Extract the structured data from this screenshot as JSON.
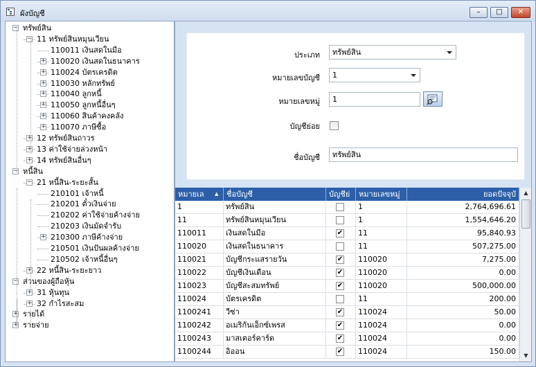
{
  "window": {
    "title": "ผังบัญชี",
    "minimize": "–",
    "maximize": "□",
    "close": "✕"
  },
  "tree": [
    {
      "label": "ทรัพย์สิน",
      "level": 0,
      "expander": "−"
    },
    {
      "label": "11 ทรัพย์สินหมุนเวียน",
      "level": 1,
      "expander": "−"
    },
    {
      "label": "110011 เงินสดในมือ",
      "level": 2,
      "expander": ""
    },
    {
      "label": "110020 เงินสดในธนาคาร",
      "level": 2,
      "expander": "+"
    },
    {
      "label": "110024 บัตรเครดิต",
      "level": 2,
      "expander": "+"
    },
    {
      "label": "110030 หลักทรัพย์",
      "level": 2,
      "expander": "+"
    },
    {
      "label": "110040 ลูกหนี้",
      "level": 2,
      "expander": "+"
    },
    {
      "label": "110050 ลูกหนี้อื่นๆ",
      "level": 2,
      "expander": "+"
    },
    {
      "label": "110060 สินค้าคงคลัง",
      "level": 2,
      "expander": "+"
    },
    {
      "label": "110070 ภาษีซื้อ",
      "level": 2,
      "expander": "+"
    },
    {
      "label": "12 ทรัพย์สินถาวร",
      "level": 1,
      "expander": "+"
    },
    {
      "label": "13 ค่าใช้จ่ายล่วงหน้า",
      "level": 1,
      "expander": "+"
    },
    {
      "label": "14 ทรัพย์สินอื่นๆ",
      "level": 1,
      "expander": "+"
    },
    {
      "label": "หนี้สิน",
      "level": 0,
      "expander": "−"
    },
    {
      "label": "21 หนี้สิน-ระยะสั้น",
      "level": 1,
      "expander": "−"
    },
    {
      "label": "210101 เจ้าหนี้",
      "level": 2,
      "expander": ""
    },
    {
      "label": "210201 ตั๋วเงินจ่าย",
      "level": 2,
      "expander": ""
    },
    {
      "label": "210202 ค่าใช้จ่ายค้างจ่าย",
      "level": 2,
      "expander": ""
    },
    {
      "label": "210203 เงินมัดจำรับ",
      "level": 2,
      "expander": ""
    },
    {
      "label": "210300 ภาษีค้างจ่าย",
      "level": 2,
      "expander": "+"
    },
    {
      "label": "210501 เงินปันผลค้างจ่าย",
      "level": 2,
      "expander": ""
    },
    {
      "label": "210502 เจ้าหนี้อื่นๆ",
      "level": 2,
      "expander": ""
    },
    {
      "label": "22 หนี้สิน-ระยะยาว",
      "level": 1,
      "expander": "+"
    },
    {
      "label": "ส่วนของผู้ถือหุ้น",
      "level": 0,
      "expander": "−"
    },
    {
      "label": "31 หุ้นทุน",
      "level": 1,
      "expander": "+"
    },
    {
      "label": "32 กำไรสะสม",
      "level": 1,
      "expander": "+"
    },
    {
      "label": "รายได้",
      "level": 0,
      "expander": "+"
    },
    {
      "label": "รายจ่าย",
      "level": 0,
      "expander": "+"
    }
  ],
  "form": {
    "type_label": "ประเภท",
    "type_value": "ทรัพย์สิน",
    "account_no_label": "หมายเลขบัญชี",
    "account_no_value": "1",
    "group_no_label": "หมายเลขหมู่",
    "group_no_value": "1",
    "sub_account_label": "บัญชีย่อย",
    "sub_account_checked": false,
    "account_name_label": "ชื่อบัญชี",
    "account_name_value": "ทรัพย์สิน"
  },
  "grid": {
    "columns": [
      "หมายเล",
      "ชื่อบัญชี",
      "บัญชีย่",
      "หมายเลขหมู่",
      "ยอดปัจจุบั"
    ],
    "sort_indicator": "▲",
    "rows": [
      {
        "no": "1",
        "name": "ทรัพย์สิน",
        "sub": false,
        "group": "1",
        "balance": "2,764,696.61"
      },
      {
        "no": "11",
        "name": "ทรัพย์สินหมุนเวียน",
        "sub": false,
        "group": "1",
        "balance": "1,554,646.20"
      },
      {
        "no": "110011",
        "name": "เงินสดในมือ",
        "sub": true,
        "group": "11",
        "balance": "95,840.93"
      },
      {
        "no": "110020",
        "name": "เงินสดในธนาคาร",
        "sub": false,
        "group": "11",
        "balance": "507,275.00"
      },
      {
        "no": "110021",
        "name": "บัญชีกระแสรายวัน",
        "sub": true,
        "group": "110020",
        "balance": "7,275.00"
      },
      {
        "no": "110022",
        "name": "บัญชีเงินเดือน",
        "sub": true,
        "group": "110020",
        "balance": "0.00"
      },
      {
        "no": "110023",
        "name": "บัญชีสะสมทรัพย์",
        "sub": true,
        "group": "110020",
        "balance": "500,000.00"
      },
      {
        "no": "110024",
        "name": "บัตรเครดิต",
        "sub": false,
        "group": "11",
        "balance": "200.00"
      },
      {
        "no": "1100241",
        "name": "วีซ่า",
        "sub": true,
        "group": "110024",
        "balance": "50.00"
      },
      {
        "no": "1100242",
        "name": "อเมริกันเอ็กซ์เพรส",
        "sub": true,
        "group": "110024",
        "balance": "0.00"
      },
      {
        "no": "1100243",
        "name": "มาสเตอร์คาร์ด",
        "sub": true,
        "group": "110024",
        "balance": "0.00"
      },
      {
        "no": "1100244",
        "name": "อิออน",
        "sub": true,
        "group": "110024",
        "balance": "150.00"
      }
    ]
  },
  "icons": {
    "app": "tree-window-icon",
    "lookup": "lookup-icon",
    "scroll_up": "▲",
    "scroll_down": "▼",
    "check": "✔"
  },
  "colors": {
    "header_bg": "#2c5fa8",
    "window_bg": "#d6e3f3"
  }
}
